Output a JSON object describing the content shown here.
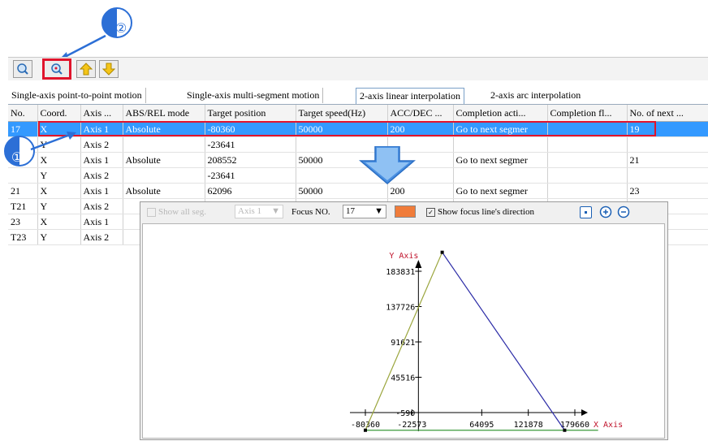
{
  "callouts": [
    "②",
    "①"
  ],
  "toolbar": {
    "buttons": [
      "show-path-icon",
      "focus-path-icon",
      "move-up-icon",
      "move-down-icon"
    ]
  },
  "tabs": [
    "Single-axis point-to-point motion",
    "Single-axis multi-segment motion",
    "2-axis linear interpolation",
    "2-axis arc interpolation"
  ],
  "active_tab": 2,
  "table": {
    "headers": [
      "No.",
      "Coord.",
      "Axis ...",
      "ABS/REL mode",
      "Target position",
      "Target speed(Hz)",
      "ACC/DEC ...",
      "Completion acti...",
      "Completion fl...",
      "No. of next ..."
    ],
    "rows": [
      [
        "17",
        "X",
        "Axis 1",
        "Absolute",
        "-80360",
        "50000",
        "200",
        "Go to next segmer",
        "",
        "19"
      ],
      [
        "",
        "Y",
        "Axis 2",
        "",
        "-23641",
        "",
        "",
        "",
        "",
        ""
      ],
      [
        "",
        "X",
        "Axis 1",
        "Absolute",
        "208552",
        "50000",
        "",
        "Go to next segmer",
        "",
        "21"
      ],
      [
        "",
        "Y",
        "Axis 2",
        "",
        "-23641",
        "",
        "",
        "",
        "",
        ""
      ],
      [
        "21",
        "X",
        "Axis 1",
        "Absolute",
        "62096",
        "50000",
        "200",
        "Go to next segmer",
        "",
        "23"
      ],
      [
        "T21",
        "Y",
        "Axis 2",
        "",
        "",
        "",
        "",
        "",
        "",
        ""
      ],
      [
        "23",
        "X",
        "Axis 1",
        "",
        "",
        "",
        "",
        "",
        "",
        ""
      ],
      [
        "T23",
        "Y",
        "Axis 2",
        "",
        "",
        "",
        "",
        "",
        "",
        ""
      ]
    ],
    "selected_row": 0
  },
  "chart_window": {
    "show_all_label": "Show all seg.",
    "axis_select": "Axis 1",
    "focus_label": "Focus NO.",
    "focus_value": "17",
    "focus_color": "#f07c3a",
    "show_direction_label": "Show focus line's direction",
    "show_direction_checked": true
  },
  "chart_data": {
    "type": "line",
    "xlabel": "X Axis",
    "ylabel": "Y Axis",
    "x_ticks": [
      "-80360",
      "-22573",
      "64095",
      "121878",
      "179660"
    ],
    "y_ticks": [
      "-590",
      "45516",
      "91621",
      "137726",
      "183831"
    ],
    "xlim": [
      -100000,
      210000
    ],
    "ylim": [
      -23641,
      235000
    ],
    "series": [
      {
        "color": "#9aa53c",
        "values": [
          [
            -80360,
            -23641
          ],
          [
            15000,
            208552
          ]
        ]
      },
      {
        "color": "#2a2aa6",
        "values": [
          [
            15000,
            208552
          ],
          [
            167000,
            -23641
          ]
        ]
      },
      {
        "color": "#3a9a3a",
        "values": [
          [
            -80360,
            -23641
          ],
          [
            208552,
            -23641
          ]
        ]
      }
    ]
  }
}
